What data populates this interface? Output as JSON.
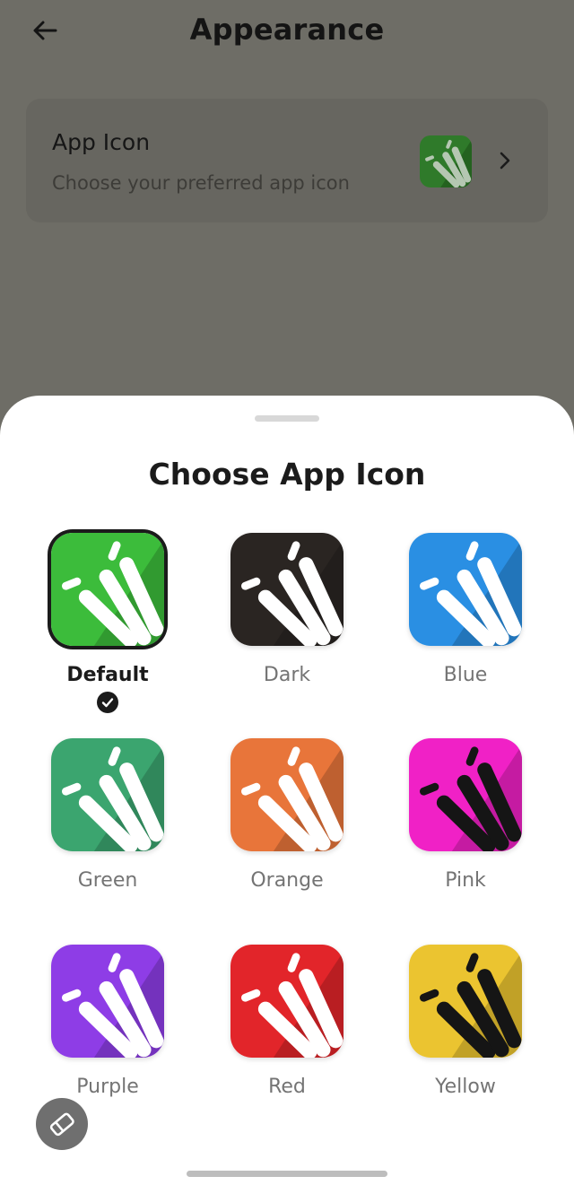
{
  "header": {
    "title": "Appearance",
    "back_icon": "arrow-left-icon"
  },
  "settings_card": {
    "title": "App Icon",
    "subtitle": "Choose your preferred app icon",
    "current_icon_color": "#2f7a2a",
    "chevron_icon": "chevron-right-icon"
  },
  "sheet": {
    "title": "Choose App Icon",
    "selected": "Default",
    "options": [
      {
        "label": "Default",
        "bg": "#3cbc3b",
        "stroke": "#ffffff",
        "selected": true
      },
      {
        "label": "Dark",
        "bg": "#2a2522",
        "stroke": "#ffffff",
        "selected": false
      },
      {
        "label": "Blue",
        "bg": "#2a8fe3",
        "stroke": "#ffffff",
        "selected": false
      },
      {
        "label": "Green",
        "bg": "#3ba56f",
        "stroke": "#ffffff",
        "selected": false
      },
      {
        "label": "Orange",
        "bg": "#e8753a",
        "stroke": "#ffffff",
        "selected": false
      },
      {
        "label": "Pink",
        "bg": "#f021c6",
        "stroke": "#151515",
        "selected": false
      },
      {
        "label": "Purple",
        "bg": "#8e3de6",
        "stroke": "#ffffff",
        "selected": false
      },
      {
        "label": "Red",
        "bg": "#e2252a",
        "stroke": "#ffffff",
        "selected": false
      },
      {
        "label": "Yellow",
        "bg": "#ebc430",
        "stroke": "#151515",
        "selected": false
      }
    ],
    "fab_icon": "eraser-icon"
  }
}
